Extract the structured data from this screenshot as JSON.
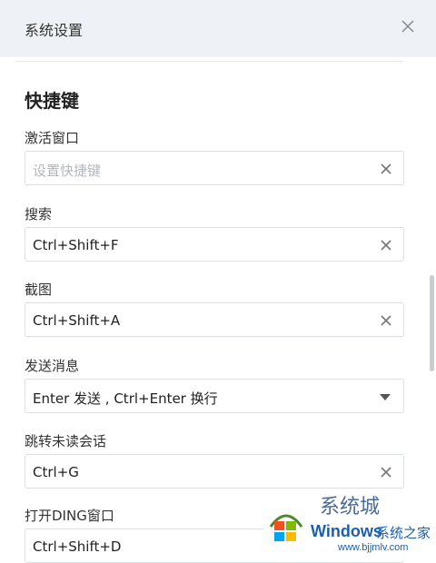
{
  "window": {
    "title": "系统设置"
  },
  "section": {
    "title": "快捷键"
  },
  "shortcuts": [
    {
      "label": "激活窗口",
      "value": "",
      "placeholder": "设置快捷键",
      "control": "clear"
    },
    {
      "label": "搜索",
      "value": "Ctrl+Shift+F",
      "control": "clear"
    },
    {
      "label": "截图",
      "value": "Ctrl+Shift+A",
      "control": "clear"
    },
    {
      "label": "发送消息",
      "value": "Enter 发送 , Ctrl+Enter 换行",
      "control": "dropdown"
    },
    {
      "label": "跳转未读会话",
      "value": "Ctrl+G",
      "control": "clear"
    },
    {
      "label": "打开DING窗口",
      "value": "Ctrl+Shift+D",
      "control": "clear"
    }
  ],
  "watermark": {
    "top_text": "系统城",
    "brand": "Windows",
    "brand_cn": "系统之家",
    "url": "www.bjjmlv.com"
  },
  "icons": {
    "close": "close-icon",
    "clear": "clear-icon",
    "dropdown": "caret-down-icon"
  },
  "colors": {
    "titlebar_bg": "#eef1f5",
    "border": "#dcdfe4",
    "placeholder": "#b3b7bd",
    "watermark_blue": "#1b5fae"
  }
}
